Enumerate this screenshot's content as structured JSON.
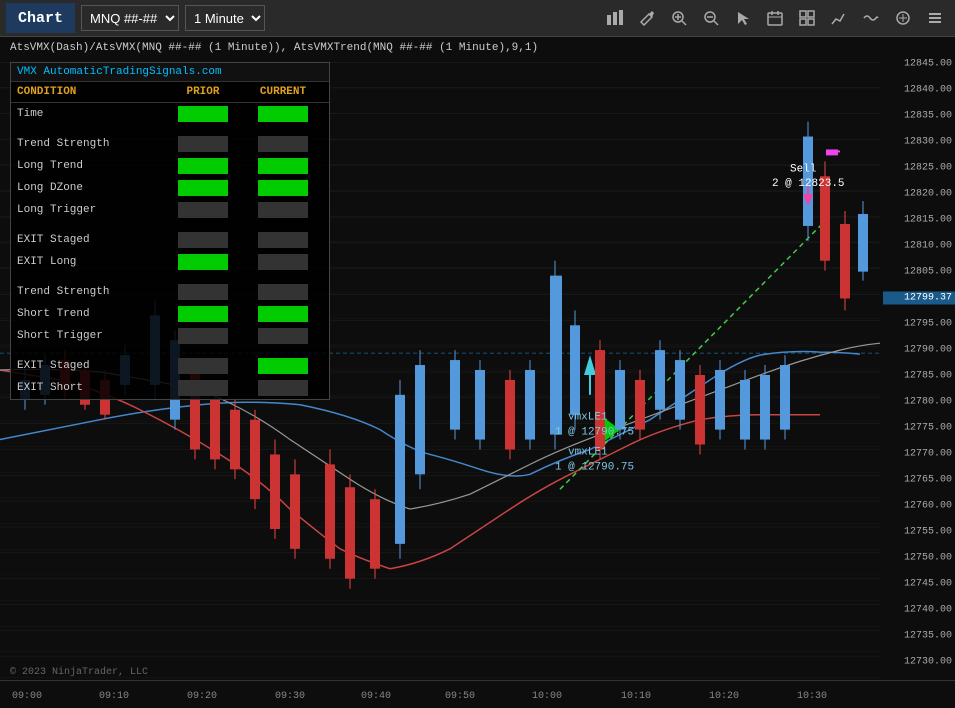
{
  "header": {
    "title": "Chart",
    "instrument_select": "MNQ ##-##",
    "timeframe_select": "1 Minute",
    "icons": [
      {
        "name": "bar-chart-icon",
        "symbol": "📊"
      },
      {
        "name": "pencil-icon",
        "symbol": "✏"
      },
      {
        "name": "zoom-in-icon",
        "symbol": "🔍"
      },
      {
        "name": "zoom-out-icon",
        "symbol": "🔎"
      },
      {
        "name": "cursor-icon",
        "symbol": "↖"
      },
      {
        "name": "calendar-icon",
        "symbol": "📅"
      },
      {
        "name": "chart-layout-icon",
        "symbol": "⊞"
      },
      {
        "name": "line-chart-icon",
        "symbol": "📈"
      },
      {
        "name": "wave-icon",
        "symbol": "〜"
      },
      {
        "name": "indicator-icon",
        "symbol": "⊕"
      },
      {
        "name": "menu-icon",
        "symbol": "☰"
      }
    ]
  },
  "chart": {
    "subtitle": "AtsVMX(Dash)/AtsVMX(MNQ ##-## (1 Minute)), AtsVMXTrend(MNQ ##-## (1 Minute),9,1)",
    "copyright": "© 2023 NinjaTrader, LLC"
  },
  "vmx_panel": {
    "title": "VMX AutomaticTradingSignals.com",
    "headers": {
      "condition": "CONDITION",
      "prior": "PRIOR",
      "current": "CURRENT"
    },
    "rows": [
      {
        "label": "Time",
        "prior": "green",
        "current": "green"
      },
      {
        "label": "",
        "prior": "",
        "current": ""
      },
      {
        "label": "Trend Strength",
        "prior": "dark",
        "current": "dark"
      },
      {
        "label": "Long Trend",
        "prior": "green",
        "current": "green"
      },
      {
        "label": "Long DZone",
        "prior": "green",
        "current": "green"
      },
      {
        "label": "Long Trigger",
        "prior": "dark",
        "current": "dark"
      },
      {
        "label": "",
        "prior": "",
        "current": ""
      },
      {
        "label": "EXIT Staged",
        "prior": "dark",
        "current": "dark"
      },
      {
        "label": "EXIT Long",
        "prior": "green",
        "current": "dark"
      },
      {
        "label": "",
        "prior": "",
        "current": ""
      },
      {
        "label": "Trend Strength",
        "prior": "dark",
        "current": "dark"
      },
      {
        "label": "Short Trend",
        "prior": "green",
        "current": "green"
      },
      {
        "label": "Short Trigger",
        "prior": "dark",
        "current": "dark"
      },
      {
        "label": "",
        "prior": "",
        "current": ""
      },
      {
        "label": "EXIT Staged",
        "prior": "dark",
        "current": "green"
      },
      {
        "label": "EXIT Short",
        "prior": "dark",
        "current": "dark"
      }
    ]
  },
  "annotations": {
    "sell": {
      "text": "Sell",
      "quantity": "2 @ 12823.5"
    },
    "vmxle1_1": {
      "line1": "vmxLE1",
      "line2": "1 @ 12790.75"
    },
    "vmxle1_2": {
      "line1": "vmxLE1",
      "line2": "1 @ 12790.75"
    }
  },
  "price_axis": {
    "labels": [
      "12845.00",
      "12840.00",
      "12835.00",
      "12830.00",
      "12825.00",
      "12820.00",
      "12815.00",
      "12810.00",
      "12805.00",
      "12799.37",
      "12795.00",
      "12790.00",
      "12785.00",
      "12780.00",
      "12775.00",
      "12770.00",
      "12765.00",
      "12760.00",
      "12755.00",
      "12750.00",
      "12745.00",
      "12740.00",
      "12735.00",
      "12730.00"
    ],
    "current_price": "12799.37"
  },
  "time_axis": {
    "labels": [
      "09:00",
      "09:10",
      "09:20",
      "09:30",
      "09:40",
      "09:50",
      "10:00",
      "10:10",
      "10:20",
      "10:30"
    ]
  }
}
